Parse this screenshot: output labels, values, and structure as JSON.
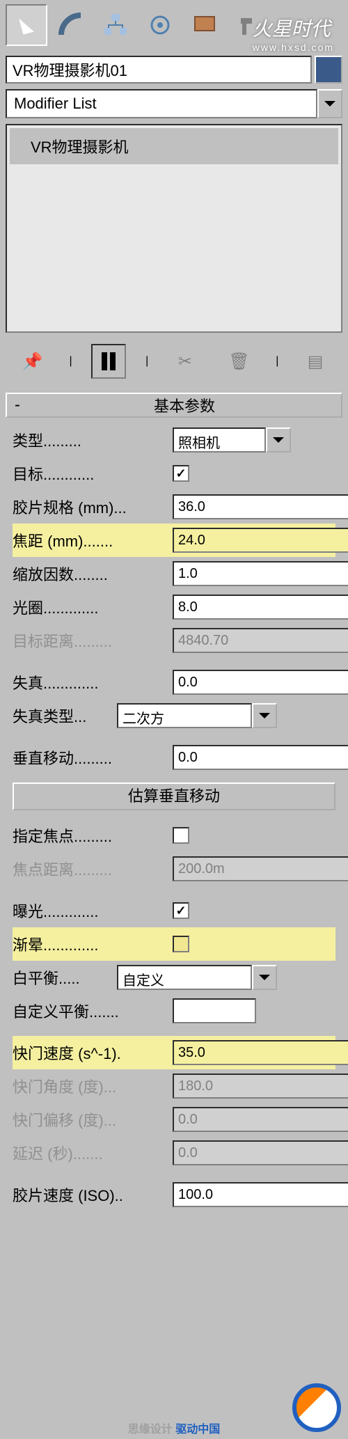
{
  "watermark": {
    "title": "火星时代",
    "url": "www.hxsd.com"
  },
  "objectName": "VR物理摄影机01",
  "modifierListLabel": "Modifier List",
  "modstack": {
    "items": [
      "VR物理摄影机"
    ]
  },
  "rollout": {
    "title": "基本参数"
  },
  "params": {
    "type": {
      "label": "类型.........",
      "value": "照相机"
    },
    "target": {
      "label": "目标............",
      "checked": "✓"
    },
    "filmGate": {
      "label": "胶片规格 (mm)...",
      "value": "36.0"
    },
    "focalLength": {
      "label": "焦距 (mm).......",
      "value": "24.0"
    },
    "zoomFactor": {
      "label": "缩放因数........",
      "value": "1.0"
    },
    "aperture": {
      "label": "光圈.............",
      "value": "8.0"
    },
    "targetDist": {
      "label": "目标距离.........",
      "value": "4840.70"
    },
    "distortion": {
      "label": "失真.............",
      "value": "0.0"
    },
    "distortionType": {
      "label": "失真类型...",
      "value": "二次方"
    },
    "verticalShift": {
      "label": "垂直移动.........",
      "value": "0.0"
    },
    "guessVertical": "估算垂直移动",
    "specifyFocus": {
      "label": "指定焦点........."
    },
    "focusDist": {
      "label": "焦点距离.........",
      "value": "200.0m"
    },
    "exposure": {
      "label": "曝光.............",
      "checked": "✓"
    },
    "vignetting": {
      "label": "渐晕............."
    },
    "whiteBalance": {
      "label": "白平衡.....",
      "value": "自定义"
    },
    "customBalance": {
      "label": "自定义平衡......."
    },
    "shutterSpeed": {
      "label": "快门速度 (s^-1).",
      "value": "35.0"
    },
    "shutterAngle": {
      "label": "快门角度 (度)...",
      "value": "180.0"
    },
    "shutterOffset": {
      "label": "快门偏移 (度)...",
      "value": "0.0"
    },
    "latency": {
      "label": "延迟 (秒).......",
      "value": "0.0"
    },
    "filmSpeed": {
      "label": "胶片速度 (ISO)..",
      "value": "100.0"
    }
  },
  "footer": {
    "gray": "思缘设计",
    "blue": "驱动中国"
  }
}
